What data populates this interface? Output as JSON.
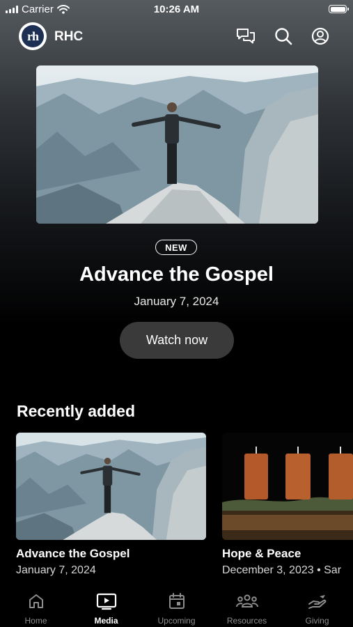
{
  "status_bar": {
    "carrier": "Carrier",
    "time": "10:26 AM"
  },
  "header": {
    "logo_text": "rh",
    "app_name": "RHC",
    "icons": [
      "chat-icon",
      "search-icon",
      "profile-icon"
    ]
  },
  "featured": {
    "badge": "NEW",
    "title": "Advance the Gospel",
    "date": "January 7, 2024",
    "button_label": "Watch now"
  },
  "recently_added": {
    "title": "Recently added",
    "items": [
      {
        "title": "Advance the Gospel",
        "date": "January 7, 2024"
      },
      {
        "title": "Hope & Peace",
        "date": "December 3, 2023 • Sar"
      }
    ]
  },
  "tab_bar": {
    "tabs": [
      {
        "label": "Home",
        "icon": "home-icon"
      },
      {
        "label": "Media",
        "icon": "media-icon"
      },
      {
        "label": "Upcoming",
        "icon": "calendar-icon"
      },
      {
        "label": "Resources",
        "icon": "people-icon"
      },
      {
        "label": "Giving",
        "icon": "giving-icon"
      }
    ],
    "active": "Media"
  },
  "colors": {
    "background": "#000000",
    "button": "#3a3a3a",
    "inactive_tab": "#8e8e8e",
    "logo": "#1d2f52"
  }
}
